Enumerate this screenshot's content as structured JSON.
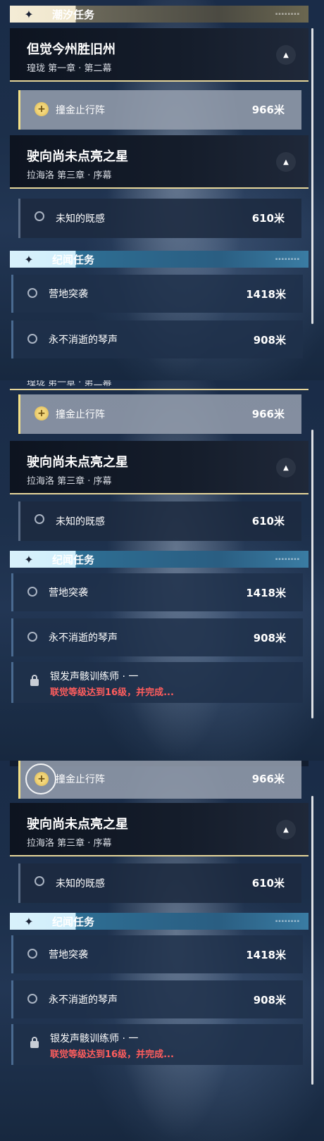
{
  "headers": {
    "tide": {
      "title": "潮汐任务",
      "star": "✦"
    },
    "chronicle": {
      "title": "纪闻任务",
      "star": "✦"
    }
  },
  "story1": {
    "title": "但觉今州胜旧州",
    "subtitle": "瑝珑 第一章 · 第二幕"
  },
  "story2": {
    "title": "驶向尚未点亮之星",
    "subtitle": "拉海洛 第三章 · 序幕"
  },
  "tasks": {
    "jinzhi": {
      "name": "撞金止行阵",
      "distance": "966米"
    },
    "weizhi": {
      "name": "未知的既感",
      "distance": "610米"
    },
    "yingdi": {
      "name": "营地突袭",
      "distance": "1418米"
    },
    "qinsheng": {
      "name": "永不消逝的琴声",
      "distance": "908米"
    }
  },
  "locked": {
    "name": "银发声骸训练师 · 一",
    "requirement": "联觉等级达到16级，并完成..."
  },
  "icons": {
    "coin": "+",
    "toggle": "▲"
  }
}
